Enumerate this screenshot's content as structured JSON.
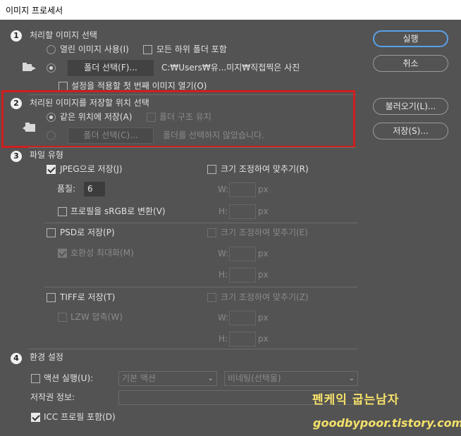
{
  "window": {
    "title": "이미지 프로세서"
  },
  "section1": {
    "number": "1",
    "title": "처리할 이미지 선택",
    "use_open_label": "열린 이미지 사용(I)",
    "include_subfolders_label": "모든 하위 폴더 포함",
    "select_folder_button": "폴더 선택(F)...",
    "folder_path": "C:₩Users₩유...미지₩직접찍은 사진",
    "open_first_label": "설정을 적용할 첫 번째 이미지 열기(O)"
  },
  "section2": {
    "number": "2",
    "title": "처리된 이미지를 저장할 위치 선택",
    "same_location_label": "같은 위치에 저장(A)",
    "keep_structure_label": "폴더 구조 유지",
    "select_folder_button": "폴더 선택(C)...",
    "no_folder_text": "폴더를 선택하지 않았습니다."
  },
  "section3": {
    "number": "3",
    "title": "파일 유형",
    "jpeg": {
      "save_label": "JPEG으로 저장(J)",
      "resize_label": "크기 조정하여 맞추기(R)",
      "quality_label": "품질:",
      "quality_value": "6",
      "w_label": "W:",
      "h_label": "H:",
      "unit": "px",
      "srgb_label": "프로필을 sRGB로 변환(V)"
    },
    "psd": {
      "save_label": "PSD로 저장(P)",
      "resize_label": "크기 조정하여 맞추기(E)",
      "compat_label": "호환성 최대화(M)",
      "w_label": "W:",
      "h_label": "H:",
      "unit": "px"
    },
    "tiff": {
      "save_label": "TIFF로 저장(T)",
      "resize_label": "크기 조정하여 맞추기(Z)",
      "lzw_label": "LZW 압축(W)",
      "w_label": "W:",
      "h_label": "H:",
      "unit": "px"
    }
  },
  "section4": {
    "number": "4",
    "title": "환경 설정",
    "run_action_label": "액션 실행(U):",
    "action_set": "기본 액션",
    "action": "비네팅(선택물)",
    "copyright_label": "저작권 정보:",
    "copyright_value": "",
    "icc_label": "ICC 프로필 포함(D)"
  },
  "buttons": {
    "run": "실행",
    "cancel": "취소",
    "load": "불러오기(L)...",
    "save": "저장(S)..."
  },
  "watermark": {
    "title": "펜케익 굽는남자",
    "url": "goodbypoor.tistory.com"
  },
  "colors": {
    "background": "#535353",
    "primary_button_border": "#5aa0e8",
    "highlight_box": "#d01e1e",
    "watermark": "#f4e06a"
  }
}
